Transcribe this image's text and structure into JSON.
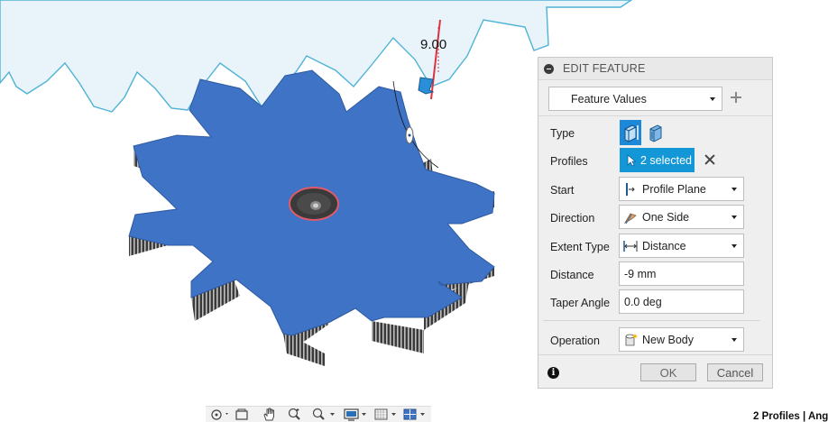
{
  "viewport": {
    "dimension_value": "9.00"
  },
  "panel": {
    "title": "EDIT FEATURE",
    "feature_dropdown": "Feature Values",
    "rows": {
      "type_label": "Type",
      "profiles_label": "Profiles",
      "profiles_value": "2 selected",
      "start_label": "Start",
      "start_value": "Profile Plane",
      "direction_label": "Direction",
      "direction_value": "One Side",
      "extent_label": "Extent Type",
      "extent_value": "Distance",
      "distance_label": "Distance",
      "distance_value": "-9 mm",
      "taper_label": "Taper Angle",
      "taper_value": "0.0 deg",
      "operation_label": "Operation",
      "operation_value": "New Body"
    },
    "ok_label": "OK",
    "cancel_label": "Cancel"
  },
  "status": {
    "text": "2 Profiles | Ang"
  },
  "colors": {
    "gear_face": "#3f73c5",
    "sketch_line": "#4fb3d6",
    "selection_blue": "#1497d6",
    "panel_bg": "#efefef"
  }
}
